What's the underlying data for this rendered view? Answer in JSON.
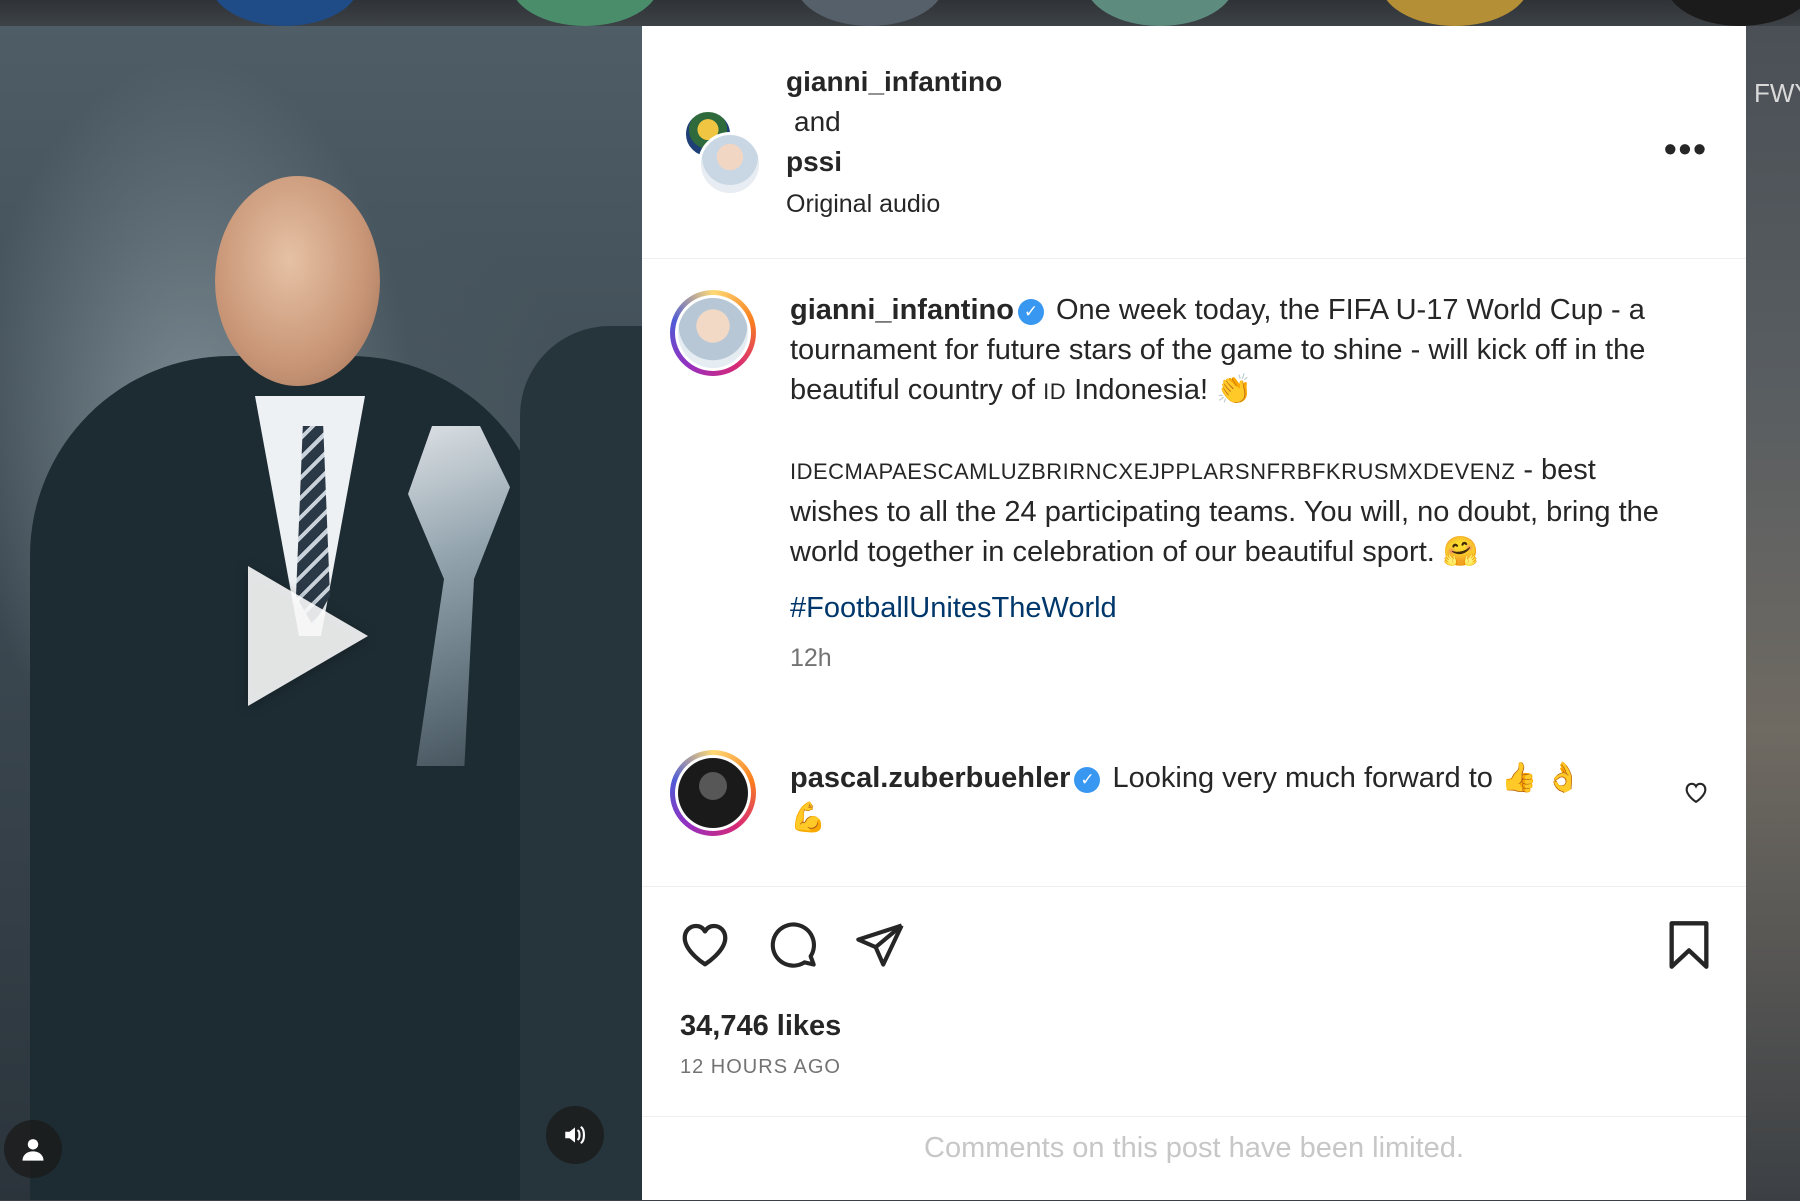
{
  "header": {
    "author": "gianni_infantino",
    "conjunction": "and",
    "coauthor": "pssi",
    "audio": "Original audio"
  },
  "background": {
    "side_label": "FWY"
  },
  "caption": {
    "username": "gianni_infantino",
    "line1": "One week today, the FIFA U-17 World Cup - a tournament for future stars of the game to shine - will kick off in the beautiful country of",
    "flag_code": "ID",
    "country": "Indonesia!",
    "emoji1": "👏",
    "codes": "IDECMAPAESCAMLUZBRIRNCXEJPPLARSNFRBFKRUSMXDEVENZ",
    "line2": "- best wishes to all the 24 participating teams. You will, no doubt, bring the world together in celebration of our beautiful sport.",
    "emoji2": "🤗",
    "hashtag": "#FootballUnitesTheWorld",
    "time": "12h"
  },
  "comment": {
    "username": "pascal.zuberbuehler",
    "text": "Looking very much forward to",
    "emojis": "👍 👌",
    "emoji_line2": "💪"
  },
  "stats": {
    "likes": "34,746 likes",
    "posted": "12 HOURS AGO"
  },
  "footer": {
    "limited": "Comments on this post have been limited."
  },
  "colors": {
    "link": "#00376b",
    "verified": "#3897f0",
    "text": "#262626",
    "muted": "#737373"
  }
}
